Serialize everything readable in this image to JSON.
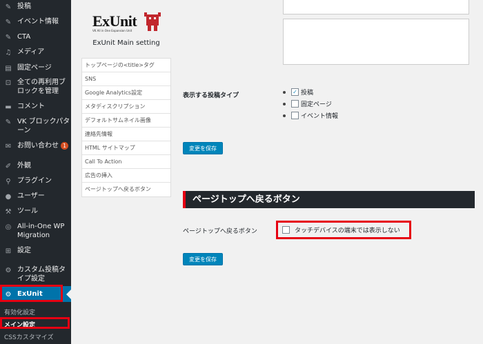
{
  "sidebar": {
    "items": [
      {
        "label": "投稿",
        "icon": "pushpin-icon"
      },
      {
        "label": "イベント情報",
        "icon": "pushpin-icon"
      },
      {
        "label": "CTA",
        "icon": "pushpin-icon"
      },
      {
        "label": "メディア",
        "icon": "media-icon"
      },
      {
        "label": "固定ページ",
        "icon": "page-icon"
      },
      {
        "label": "全ての再利用ブロックを管理",
        "icon": "block-icon"
      },
      {
        "label": "コメント",
        "icon": "comment-icon"
      },
      {
        "label": "VK ブロックパターン",
        "icon": "pushpin-icon"
      },
      {
        "label": "お問い合わせ",
        "icon": "mail-icon",
        "badge": "1"
      },
      {
        "label": "外観",
        "icon": "brush-icon"
      },
      {
        "label": "プラグイン",
        "icon": "plugin-icon"
      },
      {
        "label": "ユーザー",
        "icon": "user-icon"
      },
      {
        "label": "ツール",
        "icon": "wrench-icon"
      },
      {
        "label": "All-in-One WP Migration",
        "icon": "migration-icon"
      },
      {
        "label": "設定",
        "icon": "settings-icon"
      },
      {
        "label": "カスタム投稿タイプ設定",
        "icon": "gear-icon"
      }
    ],
    "exunit": {
      "label": "ExUnit",
      "icon": "gear-icon"
    },
    "submenu": [
      "有効化設定",
      "メイン設定",
      "CSSカスタマイズ"
    ],
    "accent": "#0073aa",
    "highlight": "#e60012"
  },
  "logo": {
    "text": "ExUnit",
    "sub": "VK All in One Expansion Unit"
  },
  "main_setting_title": "ExUnit Main setting",
  "nav_list": [
    "トップページの<title>タグ",
    "SNS",
    "Google Analytics設定",
    "メタディスクリプション",
    "デフォルトサムネイル画像",
    "連絡先情報",
    "HTML サイトマップ",
    "Call To Action",
    "広告の挿入",
    "ページトップへ戻るボタン"
  ],
  "post_types": {
    "label": "表示する投稿タイプ",
    "options": [
      {
        "label": "投稿",
        "checked": true
      },
      {
        "label": "固定ページ",
        "checked": false
      },
      {
        "label": "イベント情報",
        "checked": false
      }
    ]
  },
  "save_button_1": "変更を保存",
  "pagetop": {
    "header": "ページトップへ戻るボタン",
    "label": "ページトップへ戻るボタン",
    "option": "タッチデバイスの端末では表示しない",
    "checked": false
  },
  "save_button_2": "変更を保存"
}
